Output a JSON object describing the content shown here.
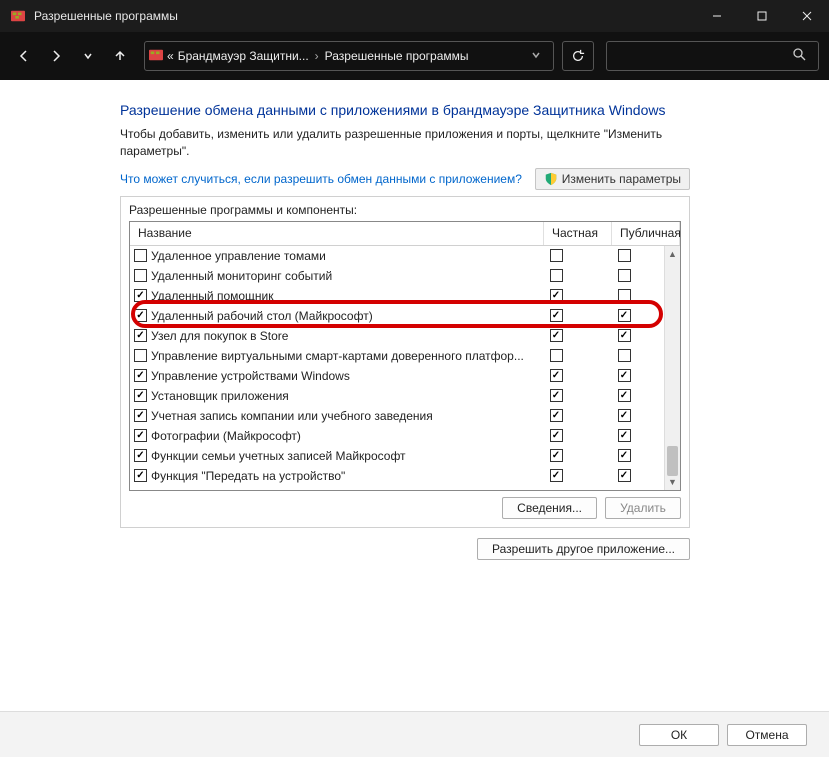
{
  "window": {
    "title": "Разрешенные программы"
  },
  "breadcrumb": {
    "prefix": "«",
    "part1": "Брандмауэр Защитни...",
    "part2": "Разрешенные программы"
  },
  "page": {
    "headline": "Разрешение обмена данными с приложениями в брандмауэре Защитника Windows",
    "subtext": "Чтобы добавить, изменить или удалить разрешенные приложения и порты, щелкните \"Изменить параметры\".",
    "help_link": "Что может случиться, если разрешить обмен данными с приложением?",
    "change_btn": "Изменить параметры",
    "group_label": "Разрешенные программы и компоненты:"
  },
  "columns": {
    "name": "Название",
    "private": "Частная",
    "public": "Публичная"
  },
  "rows": [
    {
      "enabled": false,
      "name": "Удаленное управление томами",
      "private": false,
      "public": false
    },
    {
      "enabled": false,
      "name": "Удаленный мониторинг событий",
      "private": false,
      "public": false
    },
    {
      "enabled": true,
      "name": "Удаленный помощник",
      "private": true,
      "public": false
    },
    {
      "enabled": true,
      "name": "Удаленный рабочий стол (Майкрософт)",
      "private": true,
      "public": true,
      "highlighted": true
    },
    {
      "enabled": true,
      "name": "Узел для покупок в Store",
      "private": true,
      "public": true
    },
    {
      "enabled": false,
      "name": "Управление виртуальными смарт-картами доверенного платфор...",
      "private": false,
      "public": false
    },
    {
      "enabled": true,
      "name": "Управление устройствами Windows",
      "private": true,
      "public": true
    },
    {
      "enabled": true,
      "name": "Установщик приложения",
      "private": true,
      "public": true
    },
    {
      "enabled": true,
      "name": "Учетная запись компании или учебного заведения",
      "private": true,
      "public": true
    },
    {
      "enabled": true,
      "name": "Фотографии (Майкрософт)",
      "private": true,
      "public": true
    },
    {
      "enabled": true,
      "name": "Функции семьи учетных записей Майкрософт",
      "private": true,
      "public": true
    },
    {
      "enabled": true,
      "name": "Функция \"Передать на устройство\"",
      "private": true,
      "public": true
    }
  ],
  "buttons": {
    "details": "Сведения...",
    "delete": "Удалить",
    "allow_another": "Разрешить другое приложение...",
    "ok": "ОК",
    "cancel": "Отмена"
  }
}
